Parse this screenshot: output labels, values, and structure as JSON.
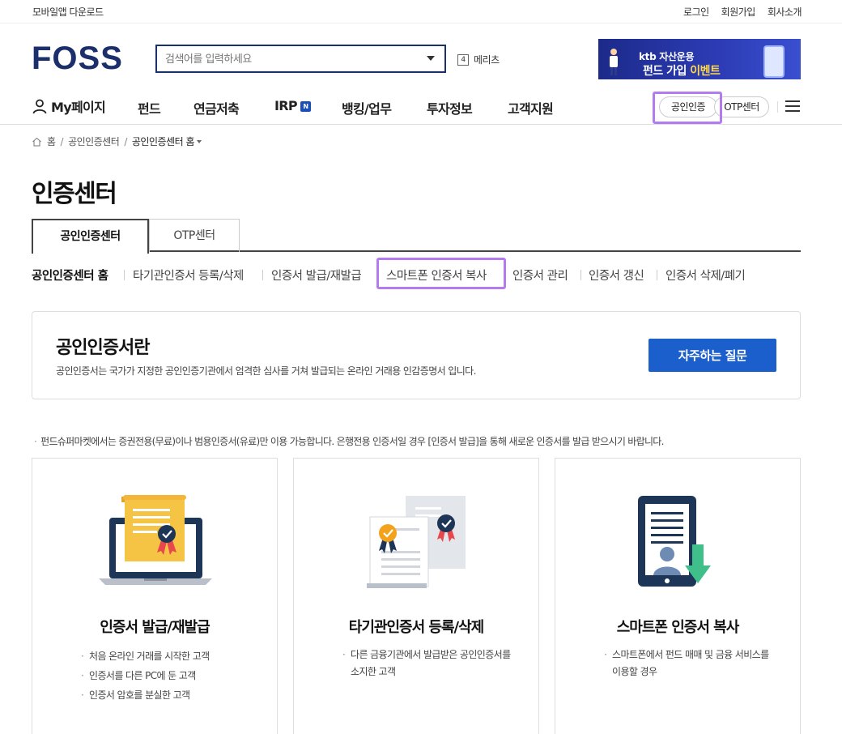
{
  "utility": {
    "mobile_app": "모바일앱 다운로드",
    "links": [
      "로그인",
      "회원가입",
      "회사소개"
    ]
  },
  "header": {
    "logo": "FOSS",
    "search_placeholder": "검색어를 입력하세요",
    "merits_num": "4",
    "merits_label": "메리츠",
    "banner": {
      "brand": "ktb 자산운용",
      "event_prefix": "펀드 가입 ",
      "event_highlight": "이벤트"
    }
  },
  "nav": {
    "mypage": "My페이지",
    "items": [
      "펀드",
      "연금저축",
      "IRP",
      "뱅킹/업무",
      "투자정보",
      "고객지원"
    ],
    "irp_badge": "N",
    "cert_button": "공인인증",
    "otp_button": "OTP센터"
  },
  "breadcrumb": {
    "home": "홈",
    "level1": "공인인증센터",
    "current": "공인인증센터 홈"
  },
  "page_title": "인증센터",
  "tabs": [
    "공인인증센터",
    "OTP센터"
  ],
  "subtabs": [
    "공인인증센터 홈",
    "타기관인증서 등록/삭제",
    "인증서 발급/재발급",
    "스마트폰 인증서 복사",
    "인증서 관리",
    "인증서 갱신",
    "인증서 삭제/폐기"
  ],
  "infobox": {
    "title": "공인인증서란",
    "desc": "공인인증서는 국가가 지정한 공인인증기관에서 엄격한 심사를 거쳐 발급되는 온라인 거래용 인감증명서 입니다.",
    "faq_button": "자주하는 질문"
  },
  "notice": "펀드슈퍼마켓에서는 증권전용(무료)이나 범용인증서(유료)만 이용 가능합니다. 은행전용 인증서일 경우 [인증서 발급]을 통해 새로운 인증서를 발급 받으시기 바랍니다.",
  "cards": [
    {
      "title": "인증서 발급/재발급",
      "items": [
        "처음 온라인 거래를 시작한 고객",
        "인증서를 다른 PC에 둔 고객",
        "인증서 암호를 분실한 고객"
      ]
    },
    {
      "title": "타기관인증서 등록/삭제",
      "items": [
        "다른 금융기관에서 발급받은 공인인증서를 소지한 고객"
      ]
    },
    {
      "title": "스마트폰 인증서 복사",
      "items": [
        "스마트폰에서 펀드 매매 및 금융 서비스를 이용할 경우"
      ]
    }
  ],
  "colors": {
    "brand_navy": "#1b2f6b",
    "primary_button": "#1b5fcd",
    "highlight": "#b47af0",
    "cert_yellow": "#f6c445",
    "ribbon_red": "#e8474b",
    "download_green": "#3fbf8a"
  }
}
